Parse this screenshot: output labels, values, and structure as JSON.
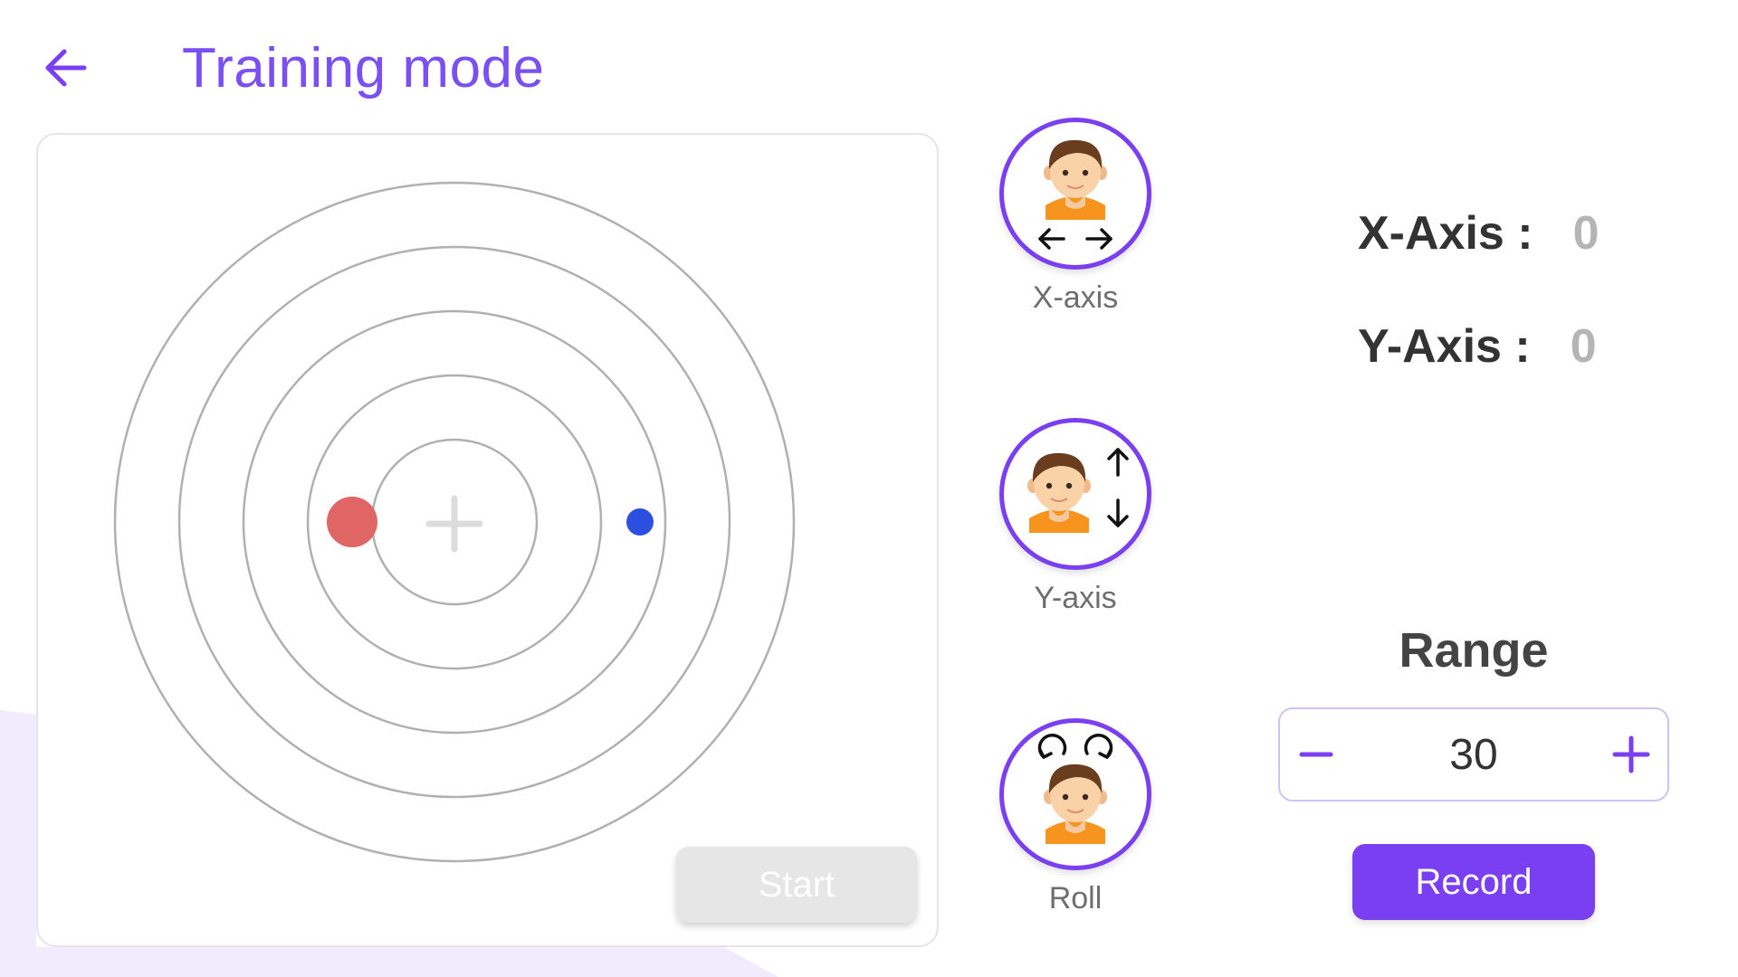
{
  "header": {
    "title": "Training mode",
    "back_icon": "arrow-left-icon"
  },
  "target": {
    "ring_count": 5,
    "center_icon": "plus-icon",
    "red_marker_color": "#e06666",
    "blue_marker_color": "#2c4fe0",
    "start_label": "Start"
  },
  "modes": [
    {
      "label": "X-axis",
      "icon": "head-left-right-icon"
    },
    {
      "label": "Y-axis",
      "icon": "head-up-down-icon"
    },
    {
      "label": "Roll",
      "icon": "head-roll-icon"
    }
  ],
  "readouts": {
    "x": {
      "label": "X-Axis :",
      "value": "0"
    },
    "y": {
      "label": "Y-Axis :",
      "value": "0"
    }
  },
  "range": {
    "title": "Range",
    "value": "30",
    "minus_icon": "minus-icon",
    "plus_icon": "plus-icon"
  },
  "record_label": "Record",
  "colors": {
    "accent": "#7a3ff0",
    "title": "#7a4ff3",
    "ring": "#b0b0b0",
    "disabled": "#e6e6e6"
  }
}
